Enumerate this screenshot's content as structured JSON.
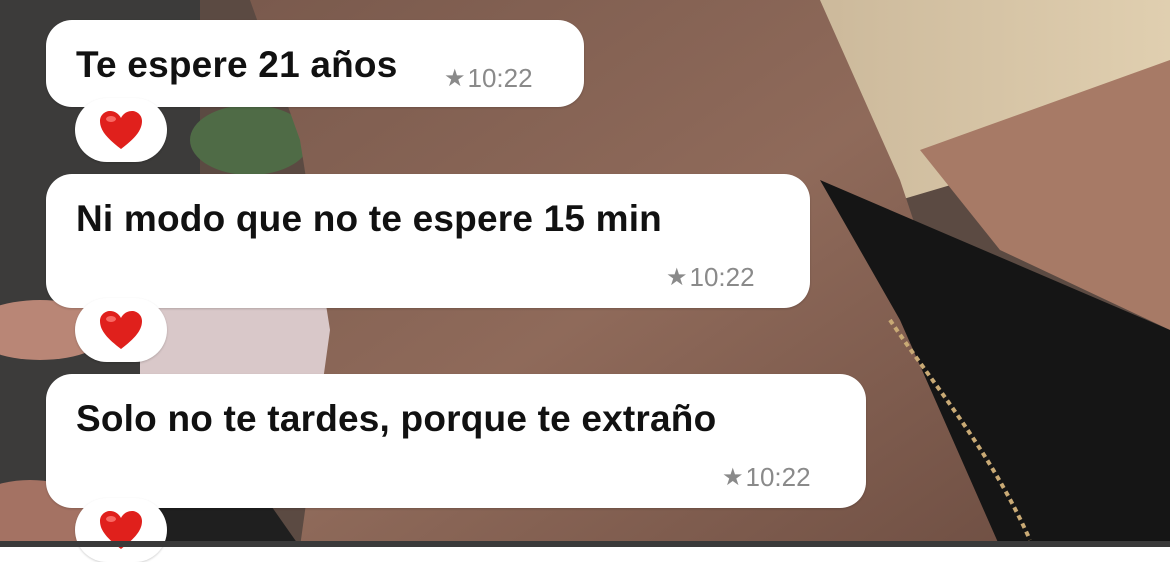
{
  "messages": [
    {
      "text": "Te espere 21 años",
      "time": "10:22",
      "starred_icon": "star-icon",
      "reaction_icon": "heart-icon"
    },
    {
      "text": "Ni modo que no te espere 15 min",
      "time": "10:22",
      "starred_icon": "star-icon",
      "reaction_icon": "heart-icon"
    },
    {
      "text": "Solo no te tardes, porque te extraño",
      "time": "10:22",
      "starred_icon": "star-icon",
      "reaction_icon": "heart-icon"
    }
  ],
  "colors": {
    "bubble": "#ffffff",
    "text": "#111111",
    "meta": "#8a8a8a",
    "heart": "#e0201c"
  }
}
